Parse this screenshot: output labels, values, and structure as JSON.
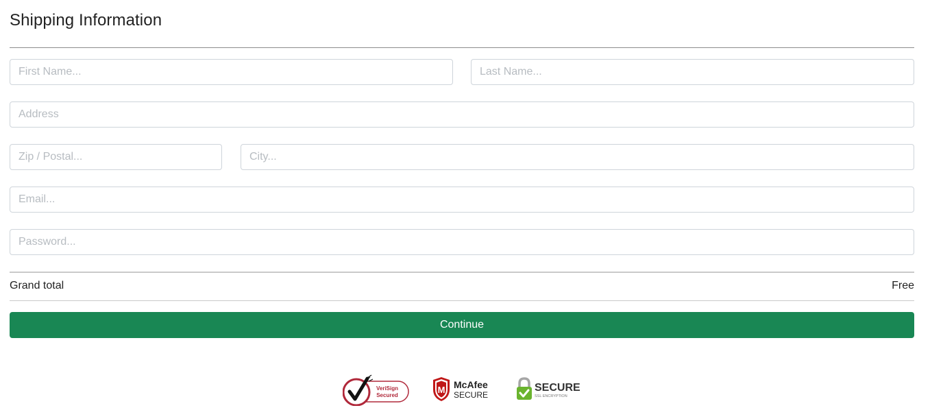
{
  "section": {
    "title": "Shipping Information"
  },
  "form": {
    "first_name": {
      "placeholder": "First Name...",
      "value": ""
    },
    "last_name": {
      "placeholder": "Last Name...",
      "value": ""
    },
    "address": {
      "placeholder": "Address",
      "value": ""
    },
    "zip": {
      "placeholder": "Zip / Postal...",
      "value": ""
    },
    "city": {
      "placeholder": "City...",
      "value": ""
    },
    "email": {
      "placeholder": "Email...",
      "value": ""
    },
    "password": {
      "placeholder": "Password...",
      "value": ""
    }
  },
  "summary": {
    "grand_total_label": "Grand total",
    "grand_total_value": "Free"
  },
  "actions": {
    "continue_label": "Continue"
  },
  "trust_badges": {
    "verisign": {
      "icon": "verisign-secured-logo",
      "line1": "VeriSign",
      "line2": "Secured"
    },
    "mcafee": {
      "icon": "mcafee-secure-logo",
      "line1": "McAfee",
      "line2": "SECURE",
      "mark": "M"
    },
    "ssl": {
      "icon": "padlock-check-icon",
      "line1": "SECURE",
      "line2": "SSL ENCRYPTION"
    }
  },
  "colors": {
    "primary_button": "#198754",
    "verisign_red": "#b0283a",
    "mcafee_red": "#c01818",
    "ssl_green": "#6ab42e"
  }
}
